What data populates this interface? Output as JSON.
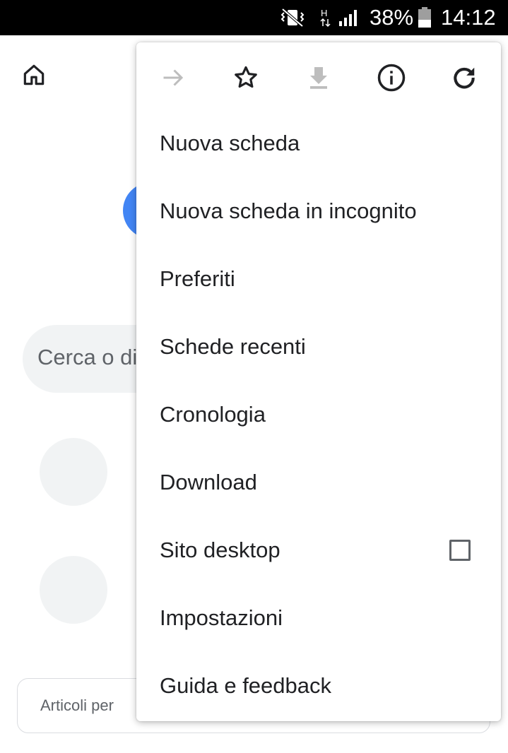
{
  "status_bar": {
    "battery_percent": "38%",
    "time": "14:12",
    "network_type": "H",
    "icons": [
      "vibrate-icon",
      "network-type-icon",
      "signal-icon",
      "battery-icon"
    ]
  },
  "background_page": {
    "search_placeholder": "Cerca o di",
    "articles_label": "Articoli per",
    "icons": [
      "home-icon"
    ],
    "colors": {
      "logo_blue": "#4285f4",
      "surface_gray": "#f1f3f4"
    }
  },
  "menu": {
    "toolbar_icons": [
      "forward-icon",
      "bookmark-star-icon",
      "download-icon",
      "page-info-icon",
      "reload-icon"
    ],
    "items": [
      {
        "label": "Nuova scheda"
      },
      {
        "label": "Nuova scheda in incognito"
      },
      {
        "label": "Preferiti"
      },
      {
        "label": "Schede recenti"
      },
      {
        "label": "Cronologia"
      },
      {
        "label": "Download"
      },
      {
        "label": "Sito desktop",
        "checkbox": false
      },
      {
        "label": "Impostazioni"
      },
      {
        "label": "Guida e feedback"
      }
    ]
  }
}
